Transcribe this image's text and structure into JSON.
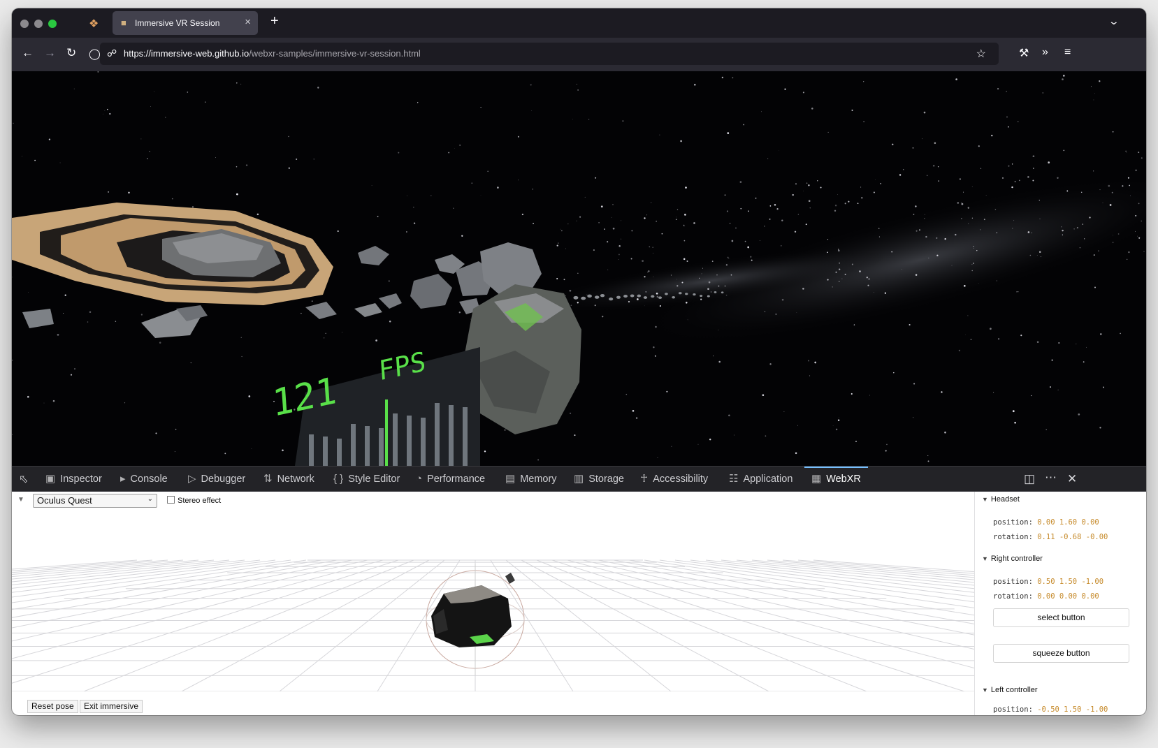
{
  "browser": {
    "tab_title": "Immersive VR Session",
    "url_host": "https://immersive-web.github.io",
    "url_path": "/webxr-samples/immersive-vr-session.html",
    "new_tab_glyph": "+",
    "tab_close_glyph": "×"
  },
  "scene": {
    "fps_value": "121",
    "fps_label": "FPS"
  },
  "devtools": {
    "tabs": [
      {
        "label": "Inspector",
        "icon": "inspector-icon"
      },
      {
        "label": "Console",
        "icon": "console-icon"
      },
      {
        "label": "Debugger",
        "icon": "debugger-icon"
      },
      {
        "label": "Network",
        "icon": "network-icon"
      },
      {
        "label": "Style Editor",
        "icon": "style-editor-icon"
      },
      {
        "label": "Performance",
        "icon": "performance-icon"
      },
      {
        "label": "Memory",
        "icon": "memory-icon"
      },
      {
        "label": "Storage",
        "icon": "storage-icon"
      },
      {
        "label": "Accessibility",
        "icon": "accessibility-icon"
      },
      {
        "label": "Application",
        "icon": "application-icon"
      },
      {
        "label": "WebXR",
        "icon": "webxr-icon",
        "active": true
      }
    ]
  },
  "webxr": {
    "device": "Oculus Quest",
    "stereo_label": "Stereo effect",
    "reset_pose": "Reset pose",
    "exit_immersive": "Exit immersive",
    "headset": {
      "title": "Headset",
      "position_label": "position:",
      "position_value": "0.00 1.60 0.00",
      "rotation_label": "rotation:",
      "rotation_value": "0.11 -0.68 -0.00"
    },
    "right_controller": {
      "title": "Right controller",
      "position_label": "position:",
      "position_value": "0.50 1.50 -1.00",
      "rotation_label": "rotation:",
      "rotation_value": "0.00 0.00 0.00",
      "select_button": "select button",
      "squeeze_button": "squeeze button"
    },
    "left_controller": {
      "title": "Left controller",
      "position_label": "position:",
      "position_value": "-0.50 1.50 -1.00"
    }
  }
}
